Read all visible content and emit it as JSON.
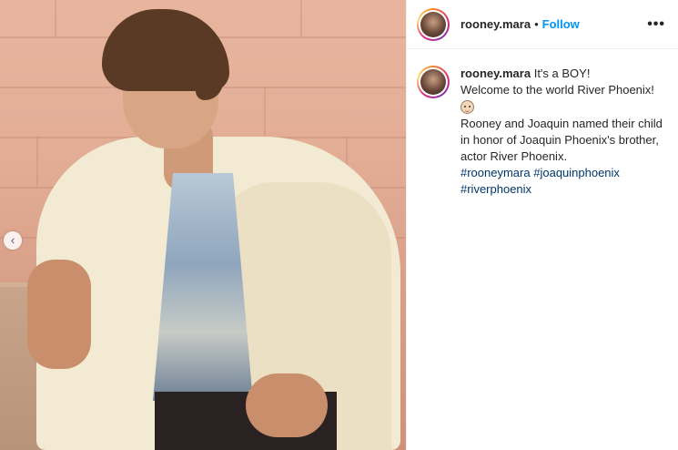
{
  "post": {
    "username": "rooney.mara",
    "dot": "•",
    "follow_label": "Follow",
    "more_label": "•••",
    "carousel_prev": "‹"
  },
  "caption": {
    "username": "rooney.mara",
    "line1": "It's a BOY!",
    "line2": "Welcome to the world River Phoenix!",
    "emoji": "baby-emoji",
    "line3": "Rooney and Joaquin named their child in honor of Joaquin Phoenix's brother, actor River Phoenix.",
    "hashtags": [
      "#rooneymara",
      "#joaquinphoenix",
      "#riverphoenix"
    ]
  },
  "icons": {
    "avatar": "profile-avatar",
    "more": "more-options-icon",
    "prev": "chevron-left-icon"
  },
  "colors": {
    "follow": "#0095f6",
    "hashtag": "#00376b",
    "text": "#262626"
  }
}
